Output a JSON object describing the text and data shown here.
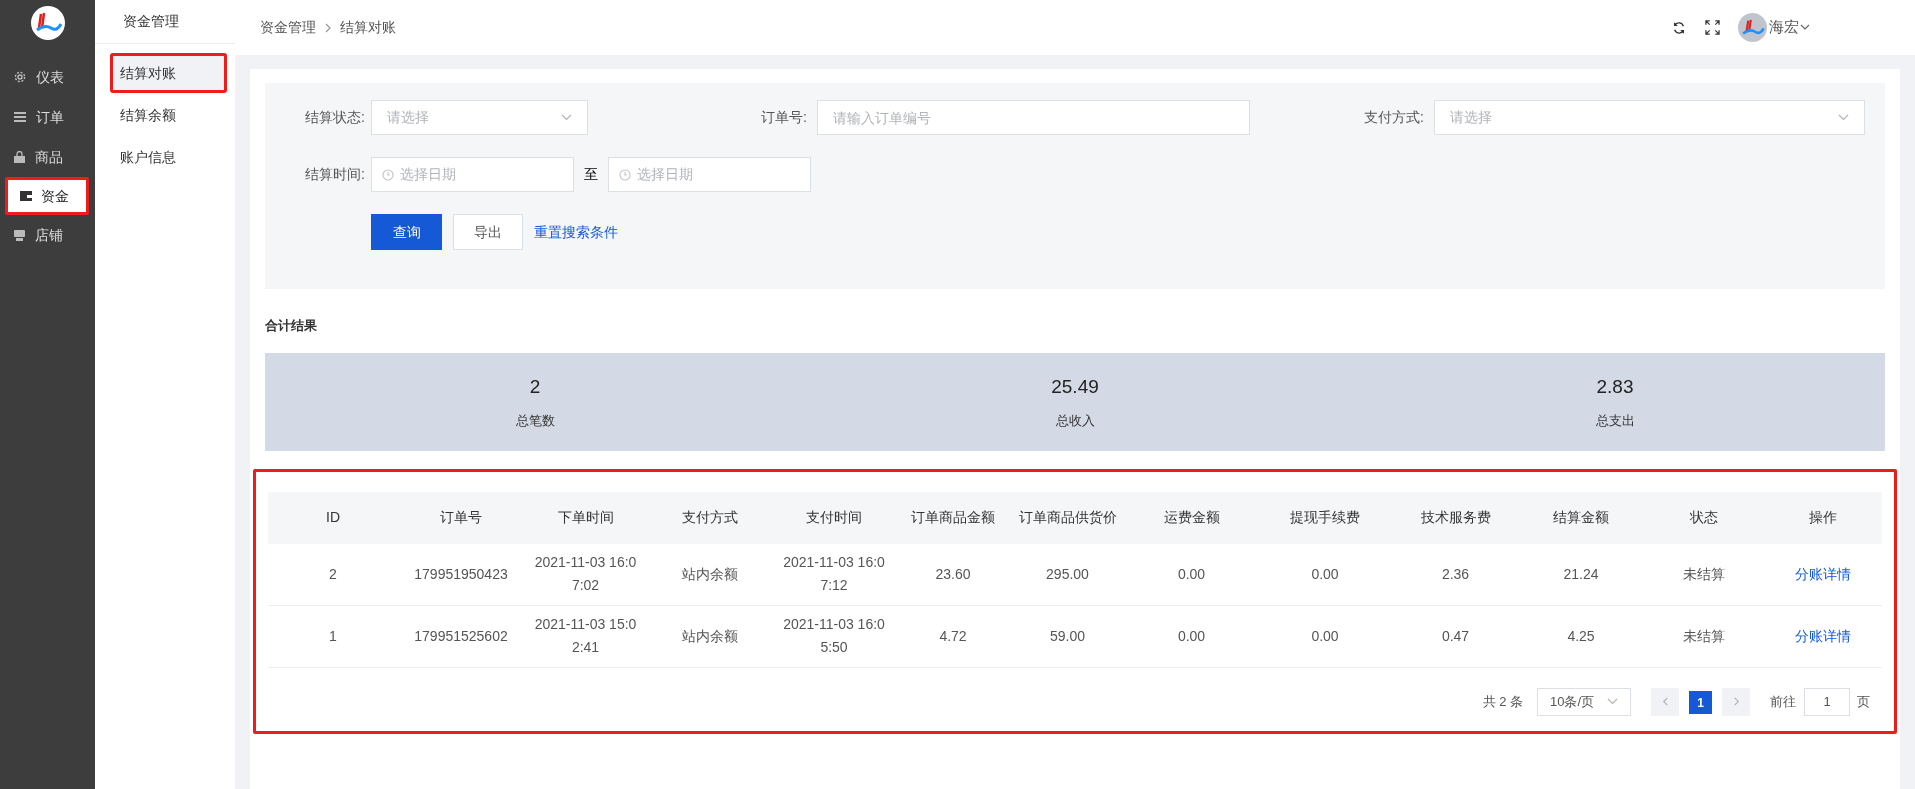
{
  "nav": [
    {
      "label": "仪表",
      "selected": false
    },
    {
      "label": "订单",
      "selected": false
    },
    {
      "label": "商品",
      "selected": false
    },
    {
      "label": "资金",
      "selected": true
    },
    {
      "label": "店铺",
      "selected": false
    }
  ],
  "submenu": {
    "title": "资金管理",
    "items": [
      {
        "label": "结算对账",
        "selected": true
      },
      {
        "label": "结算余额",
        "selected": false
      },
      {
        "label": "账户信息",
        "selected": false
      }
    ]
  },
  "breadcrumb": [
    "资金管理",
    "结算对账"
  ],
  "user": {
    "name": "海宏"
  },
  "filters": {
    "status": {
      "label": "结算状态:",
      "placeholder": "请选择"
    },
    "order_no": {
      "label": "订单号:",
      "placeholder": "请输入订单编号"
    },
    "payment": {
      "label": "支付方式:",
      "placeholder": "请选择"
    },
    "time": {
      "label": "结算时间:",
      "start_placeholder": "选择日期",
      "separator": "至",
      "end_placeholder": "选择日期"
    },
    "buttons": {
      "search": "查询",
      "export": "导出",
      "reset": "重置搜索条件"
    }
  },
  "summary": {
    "title": "合计结果",
    "stats": [
      {
        "value": "2",
        "label": "总笔数"
      },
      {
        "value": "25.49",
        "label": "总收入"
      },
      {
        "value": "2.83",
        "label": "总支出"
      }
    ]
  },
  "table": {
    "highlighted": true,
    "columns": [
      "ID",
      "订单号",
      "下单时间",
      "支付方式",
      "支付时间",
      "订单商品金额",
      "订单商品供货价",
      "运费金额",
      "提现手续费",
      "技术服务费",
      "结算金额",
      "状态",
      "操作"
    ],
    "rows": [
      [
        "2",
        "179951950423",
        "2021-11-03 16:07:02",
        "站内余额",
        "2021-11-03 16:07:12",
        "23.60",
        "295.00",
        "0.00",
        "0.00",
        "2.36",
        "21.24",
        "未结算",
        "分账详情"
      ],
      [
        "1",
        "179951525602",
        "2021-11-03 15:02:41",
        "站内余额",
        "2021-11-03 16:05:50",
        "4.72",
        "59.00",
        "0.00",
        "0.00",
        "0.47",
        "4.25",
        "未结算",
        "分账详情"
      ]
    ]
  },
  "pagination": {
    "total": "共 2 条",
    "page_size": "10条/页",
    "pages": [
      {
        "label": "1",
        "selected": true
      }
    ],
    "goto_label": "前往",
    "goto_value": "1",
    "page_suffix": "页"
  }
}
